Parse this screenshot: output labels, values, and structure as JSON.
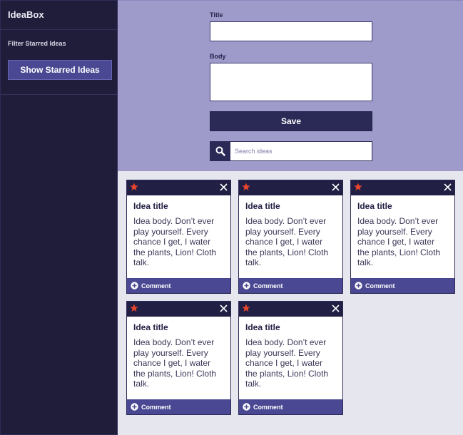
{
  "sidebar": {
    "brand": "IdeaBox",
    "filter_label": "Filter Starred Ideas",
    "starred_button": "Show Starred Ideas"
  },
  "form": {
    "title_label": "Title",
    "title_value": "",
    "body_label": "Body",
    "body_value": "",
    "save_label": "Save",
    "search_placeholder": "Search ideas"
  },
  "colors": {
    "sidebar_bg": "#1f1d3a",
    "header_bg": "#9e9bcb",
    "accent": "#4a4892",
    "star": "#e8452c"
  },
  "cards": [
    {
      "title": "Idea title",
      "body": "Idea body. Don’t ever play yourself. Every chance I get, I water the plants, Lion! Cloth talk.",
      "comment_label": "Comment",
      "starred": true
    },
    {
      "title": "Idea title",
      "body": "Idea body. Don’t ever play yourself. Every chance I get, I water the plants, Lion! Cloth talk.",
      "comment_label": "Comment",
      "starred": true
    },
    {
      "title": "Idea title",
      "body": "Idea body. Don’t ever play yourself. Every chance I get, I water the plants, Lion! Cloth talk.",
      "comment_label": "Comment",
      "starred": true
    },
    {
      "title": "Idea title",
      "body": "Idea body. Don’t ever play yourself. Every chance I get, I water the plants, Lion! Cloth talk.",
      "comment_label": "Comment",
      "starred": true
    },
    {
      "title": "Idea title",
      "body": "Idea body. Don’t ever play yourself. Every chance I get, I water the plants, Lion! Cloth talk.",
      "comment_label": "Comment",
      "starred": true
    }
  ]
}
